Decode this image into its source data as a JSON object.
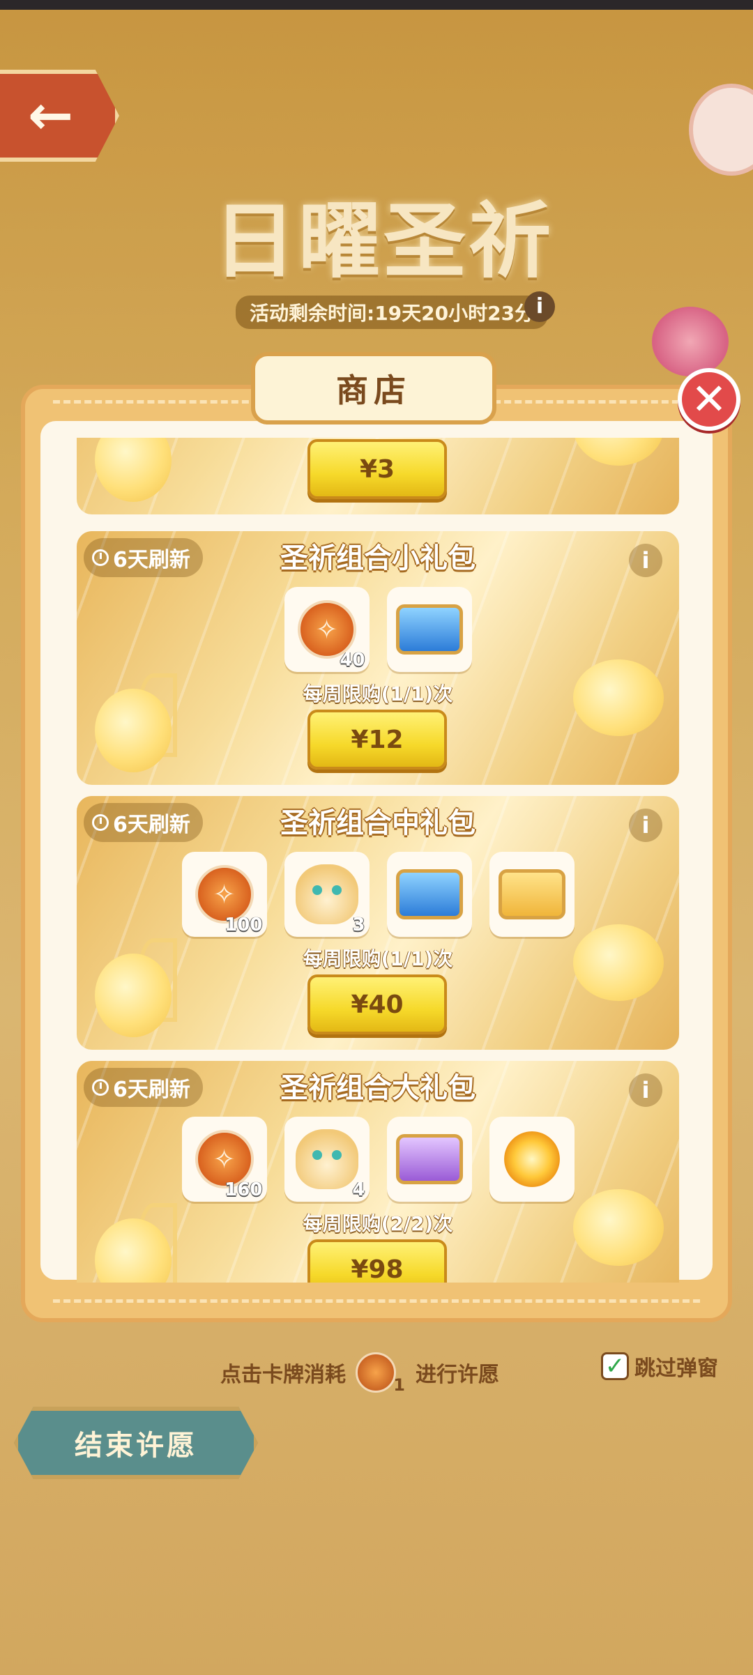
{
  "event": {
    "title": "日曜圣祈",
    "countdown": "活动剩余时间:19天20小时23分",
    "info_icon": "info-icon"
  },
  "shop": {
    "tab_label": "商店",
    "close_icon": "close-icon",
    "top_pack": {
      "price": "¥3"
    },
    "packs": [
      {
        "refresh": "6天刷新",
        "title": "圣祈组合小礼包",
        "limit": "每周限购(1/1)次",
        "price": "¥12",
        "items": [
          {
            "icon": "wish-coin-icon",
            "qty": "40"
          },
          {
            "icon": "blue-chest-icon",
            "qty": ""
          }
        ]
      },
      {
        "refresh": "6天刷新",
        "title": "圣祈组合中礼包",
        "limit": "每周限购(1/1)次",
        "price": "¥40",
        "items": [
          {
            "icon": "wish-coin-icon",
            "qty": "100"
          },
          {
            "icon": "creature-icon",
            "qty": "3"
          },
          {
            "icon": "blue-treasure-chest-icon",
            "qty": ""
          },
          {
            "icon": "gold-chest-icon",
            "qty": ""
          }
        ]
      },
      {
        "refresh": "6天刷新",
        "title": "圣祈组合大礼包",
        "limit": "每周限购(2/2)次",
        "price": "¥98",
        "items": [
          {
            "icon": "wish-coin-icon",
            "qty": "160"
          },
          {
            "icon": "creature-icon",
            "qty": "4"
          },
          {
            "icon": "purple-chest-icon",
            "qty": ""
          },
          {
            "icon": "sun-ornament-icon",
            "qty": ""
          }
        ]
      }
    ]
  },
  "bottom": {
    "hint_prefix": "点击卡牌消耗",
    "hint_cost": "1",
    "hint_suffix": "进行许愿",
    "skip_label": "跳过弹窗",
    "skip_checked": true,
    "end_button": "结束许愿"
  }
}
